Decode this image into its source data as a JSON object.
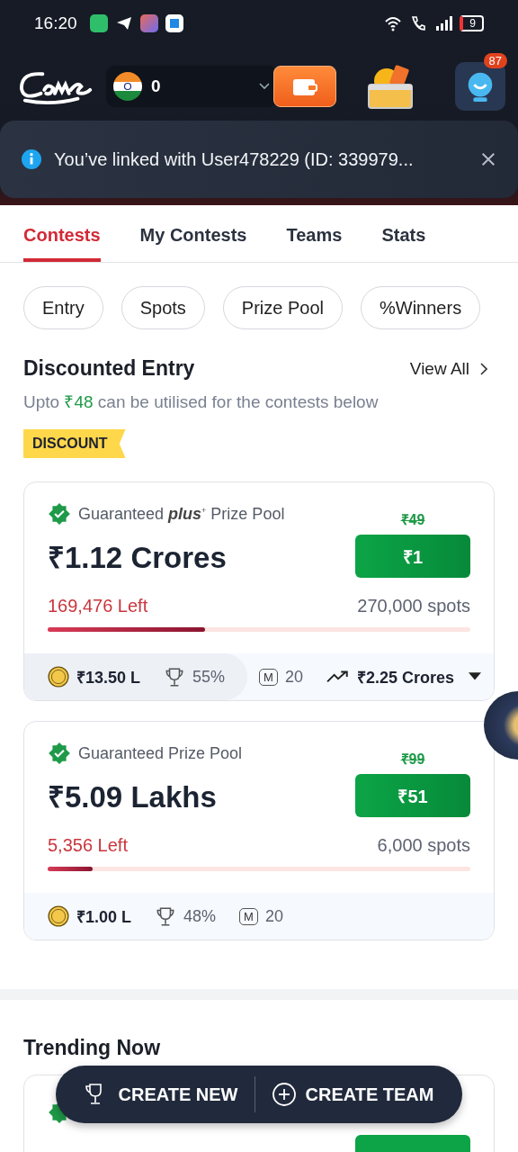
{
  "status_bar": {
    "time": "16:20",
    "battery": "9"
  },
  "header": {
    "balance": "0",
    "notification_count": "87"
  },
  "banner": {
    "message": "You’ve linked with User478229 (ID: 339979..."
  },
  "tabs": [
    {
      "label": "Contests",
      "selected": true
    },
    {
      "label": "My Contests",
      "selected": false
    },
    {
      "label": "Teams",
      "selected": false
    },
    {
      "label": "Stats",
      "selected": false
    }
  ],
  "filters": [
    {
      "label": "Entry"
    },
    {
      "label": "Spots"
    },
    {
      "label": "Prize Pool"
    },
    {
      "label": "%Winners"
    }
  ],
  "discounted": {
    "title": "Discounted Entry",
    "view_all": "View All",
    "subtitle_before": "Upto ",
    "subtitle_amount": "₹48",
    "subtitle_after": " can be utilised for the contests below",
    "tag": "DISCOUNT"
  },
  "contests": [
    {
      "pool_label": "Guaranteed **plus**$^{+}$ Prize Pool",
      "prize": "₹1.12 Crores",
      "old_price": "₹49",
      "price": "₹1",
      "left": "169,476 Left",
      "spots": "270,000 spots",
      "level": 0.372,
      "pill_stats": [
        {
          "kind": "first_prize",
          "text": "₹13.50 L"
        },
        {
          "kind": "winners",
          "text": "55%"
        }
      ],
      "stats": [
        {
          "kind": "max_entries",
          "badge": "M",
          "text": "20"
        },
        {
          "kind": "trending",
          "text": "₹2.25 Crores"
        }
      ]
    },
    {
      "pool_label": "Guaranteed Prize Pool",
      "prize": "₹5.09 Lakhs",
      "old_price": "₹99",
      "price": "₹51",
      "left": "5,356 Left",
      "spots": "6,000 spots",
      "level": 0.107,
      "stats": [
        {
          "kind": "first_prize",
          "text": "₹1.00 L"
        },
        {
          "kind": "winners",
          "text": "48%"
        },
        {
          "kind": "max_entries",
          "badge": "M",
          "text": "20"
        }
      ]
    }
  ],
  "trending": {
    "title": "Trending Now"
  },
  "action_bar": {
    "buttons": [
      {
        "kind": "create_contest",
        "label": "CREATE NEW"
      },
      {
        "kind": "create_team",
        "label": "CREATE TEAM"
      }
    ]
  }
}
